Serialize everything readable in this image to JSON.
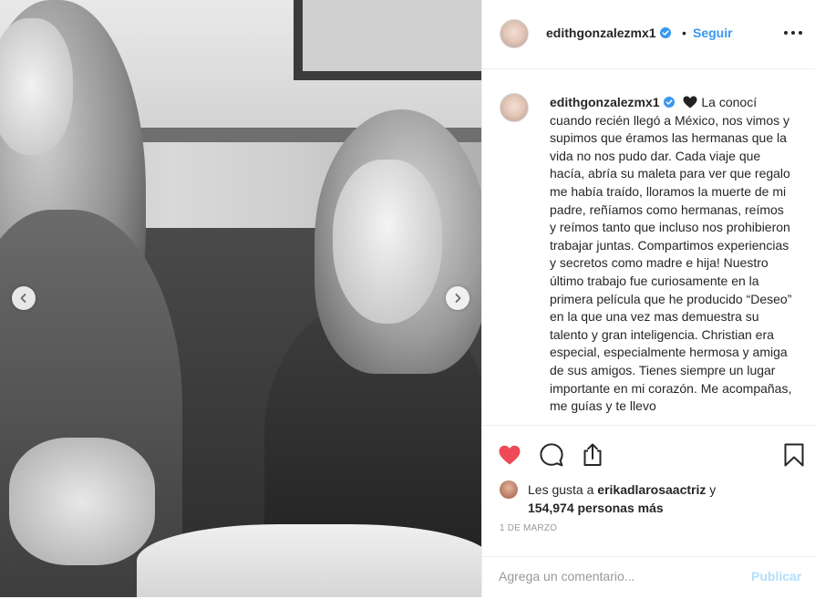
{
  "post": {
    "username": "edithgonzalezmx1",
    "separator": "•",
    "follow_label": "Seguir",
    "caption": "La conocí cuando recién llegó a México, nos vimos y supimos que éramos las hermanas que la vida no nos pudo dar. Cada viaje que hacía, abría su maleta para ver que regalo me había traído, lloramos la muerte de mi padre, reñíamos como hermanas, reímos y reímos tanto que incluso nos prohibieron trabajar juntas. Compartimos experiencias y secretos como madre e hija! Nuestro último trabajo fue curiosamente en la primera película que he producido “Deseo” en la que una vez mas demuestra su talento y gran inteligencia. Christian era especial, especialmente hermosa y amiga de sus amigos. Tienes siempre un lugar importante en mi corazón. Me acompañas, me guías y te llevo",
    "likes_prefix": "Les gusta a",
    "liked_by": "erikadlarosaactriz",
    "likes_and": "y",
    "likes_count": "154,974 personas más",
    "date": "1 DE MARZO"
  },
  "comment": {
    "placeholder": "Agrega un comentario...",
    "publish_label": "Publicar"
  },
  "colors": {
    "accent": "#3897f0",
    "like": "#ed4956",
    "publish_disabled": "#b2dffc",
    "verified": "#3897f0"
  },
  "icons": {
    "verified": "verified-badge-icon",
    "heart_emoji": "black-heart-emoji",
    "like": "heart-filled-icon",
    "comment": "comment-bubble-icon",
    "share": "share-upload-icon",
    "save": "bookmark-icon",
    "prev": "chevron-left-icon",
    "next": "chevron-right-icon",
    "more": "more-options-icon"
  }
}
